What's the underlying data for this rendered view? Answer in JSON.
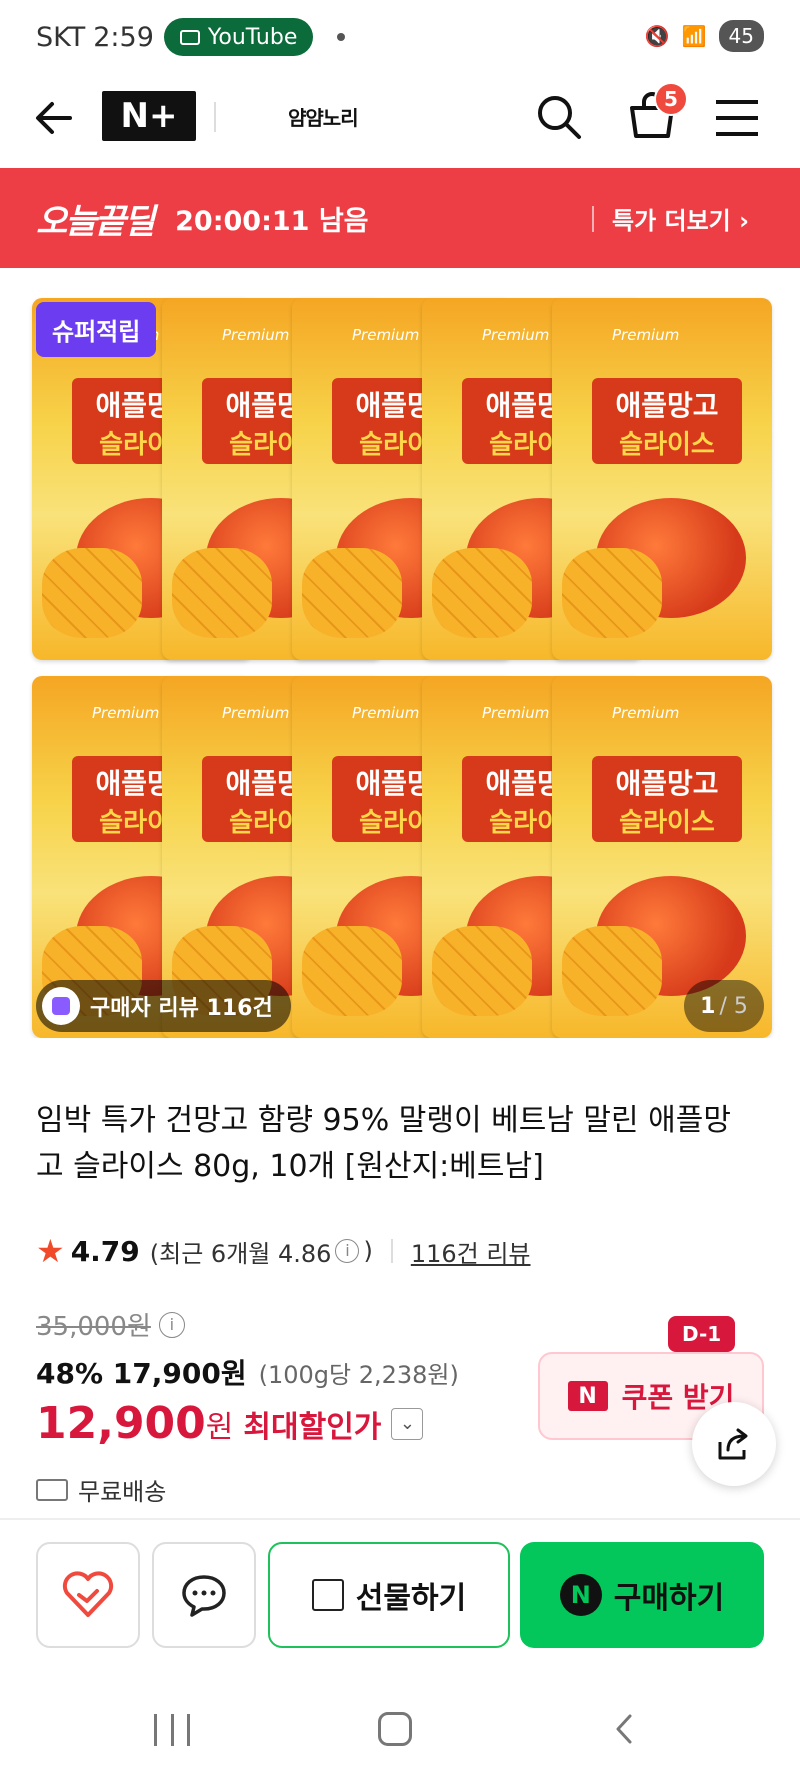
{
  "status_bar": {
    "carrier": "SKT",
    "time": "2:59",
    "app_pill": "YouTube",
    "battery": "45"
  },
  "header": {
    "nplus_label": "N+",
    "store_name": "얌얌노리"
  },
  "cart": {
    "count": "5"
  },
  "deal_banner": {
    "logo": "오늘끝딜",
    "timer": "20:00:11 남음",
    "more_label": "특가 더보기 ›"
  },
  "product_image": {
    "badge": "슈퍼적립",
    "pack_premium": "Premium",
    "pack_name_1": "애플망고",
    "pack_name_2": "슬라이스",
    "review_chip": "구매자 리뷰 116건",
    "pager_current": "1",
    "pager_total": "/ 5"
  },
  "product": {
    "title": "임박 특가 건망고 함량 95% 말랭이 베트남 말린 애플망고 슬라이스 80g, 10개 [원산지:베트남]",
    "rating_score": "4.79",
    "rating_recent": "(최근 6개월 4.86",
    "rating_recent_close": ")",
    "review_link": "116건 리뷰",
    "original_price": "35,000원",
    "discount_line": "48% 17,900원",
    "unit_price": "(100g당 2,238원)",
    "final_price": "12,900",
    "final_won": "원",
    "max_discount_label": "최대할인가",
    "shipping": "무료배송"
  },
  "coupon": {
    "label": "쿠폰 받기",
    "n_mark": "N",
    "d_badge": "D-1"
  },
  "actions": {
    "gift": "선물하기",
    "buy": "구매하기",
    "buy_mark": "N"
  },
  "colors": {
    "deal_red": "#ee3e45",
    "price_red": "#d8173d",
    "naver_green": "#03c75a",
    "badge_purple": "#6b3cf0"
  }
}
